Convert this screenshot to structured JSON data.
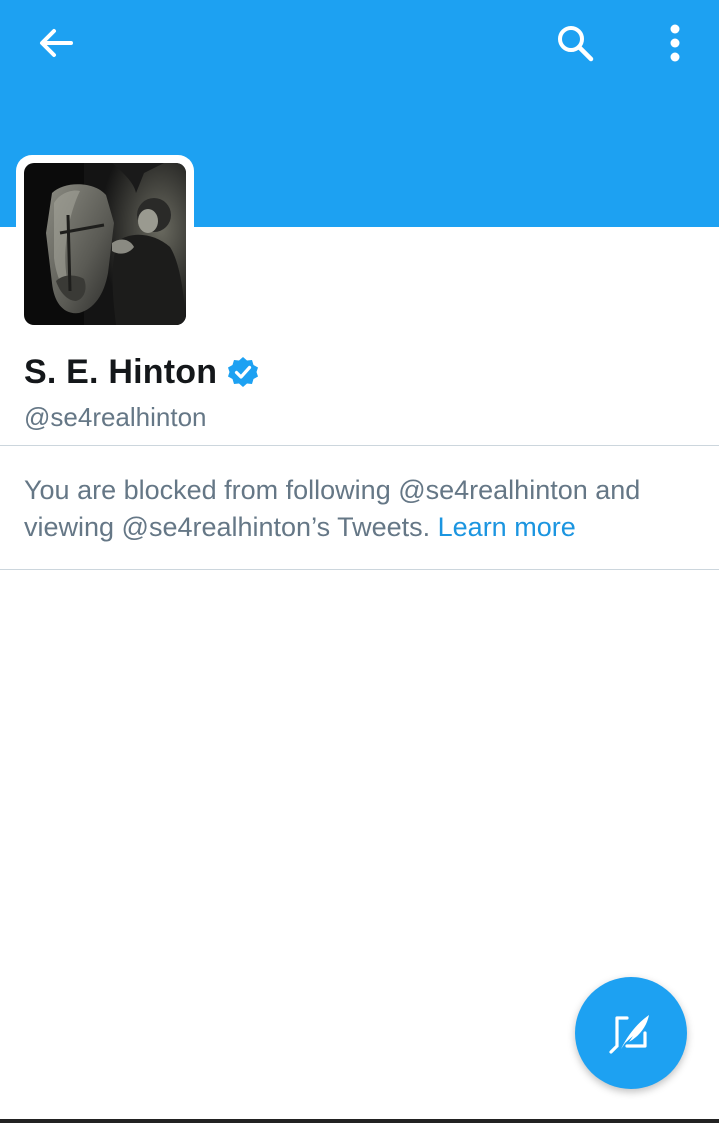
{
  "theme": {
    "header_color": "#1da1f2",
    "link_color": "#1b95e0",
    "verified_color": "#1da1f2",
    "text_primary": "#14171a",
    "text_secondary": "#657786"
  },
  "toolbar": {
    "back_icon": "arrow-left-icon",
    "search_icon": "search-icon",
    "more_icon": "more-vertical-icon"
  },
  "profile": {
    "avatar_alt": "profile photo",
    "name": "S. E. Hinton",
    "verified": true,
    "handle": "@se4realhinton"
  },
  "notice": {
    "text": "You are blocked from following @se4realhinton and viewing @se4realhinton’s Tweets. ",
    "link_label": "Learn more"
  },
  "fab": {
    "icon": "compose-tweet-icon"
  }
}
